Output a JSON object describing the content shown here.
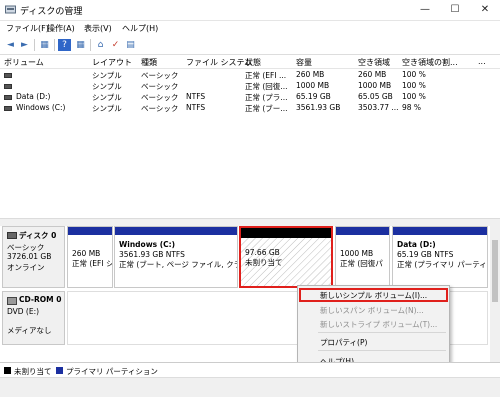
{
  "window": {
    "title": "ディスクの管理"
  },
  "window_buttons": {
    "minimize": "—",
    "maximize": "☐",
    "close": "✕"
  },
  "menu": [
    "ファイル(F)",
    "操作(A)",
    "表示(V)",
    "ヘルプ(H)"
  ],
  "toolbar": [
    "◄",
    "►",
    "▦",
    "?",
    "▦",
    "⌂",
    "✓",
    "▤"
  ],
  "columns": [
    "ボリューム",
    "レイアウト",
    "種類",
    "ファイル システム",
    "状態",
    "容量",
    "空き領域",
    "空き領域の割...",
    "..."
  ],
  "volumes": [
    {
      "name": "",
      "layout": "シンプル",
      "type": "ベーシック",
      "fs": "",
      "status": "正常 (EFI ...",
      "capacity": "260 MB",
      "free": "260 MB",
      "pct": "100 %"
    },
    {
      "name": "",
      "layout": "シンプル",
      "type": "ベーシック",
      "fs": "",
      "status": "正常 (回復...",
      "capacity": "1000 MB",
      "free": "1000 MB",
      "pct": "100 %"
    },
    {
      "name": "Data (D:)",
      "layout": "シンプル",
      "type": "ベーシック",
      "fs": "NTFS",
      "status": "正常 (プラ...",
      "capacity": "65.19 GB",
      "free": "65.05 GB",
      "pct": "100 %"
    },
    {
      "name": "Windows (C:)",
      "layout": "シンプル",
      "type": "ベーシック",
      "fs": "NTFS",
      "status": "正常 (ブー...",
      "capacity": "3561.93 GB",
      "free": "3503.77 ...",
      "pct": "98 %"
    }
  ],
  "disk0": {
    "name": "ディスク 0",
    "kind": "ベーシック",
    "size": "3726.01 GB",
    "state": "オンライン",
    "partitions": [
      {
        "title": "",
        "line1": "260 MB",
        "line2": "正常 (EFI シ"
      },
      {
        "title": "Windows (C:)",
        "line1": "3561.93 GB NTFS",
        "line2": "正常 (ブート, ページ ファイル, クラッシュ"
      },
      {
        "title": "",
        "line1": "97.66 GB",
        "line2": "未割り当て"
      },
      {
        "title": "",
        "line1": "1000 MB",
        "line2": "正常 (回復パ"
      },
      {
        "title": "Data (D:)",
        "line1": "65.19 GB NTFS",
        "line2": "正常 (プライマリ パーティショ"
      }
    ]
  },
  "cdrom0": {
    "name": "CD-ROM 0",
    "drive": "DVD (E:)",
    "state": "メディアなし"
  },
  "context_menu": [
    {
      "label": "新しいシンプル ボリューム(I)...",
      "enabled": true
    },
    {
      "label": "新しいスパン ボリューム(N)...",
      "enabled": false
    },
    {
      "label": "新しいストライプ ボリューム(T)...",
      "enabled": false
    },
    {
      "label": "プロパティ(P)",
      "enabled": true
    },
    {
      "label": "ヘルプ(H)",
      "enabled": true
    }
  ],
  "legend": {
    "unallocated": "未割り当て",
    "primary": "プライマリ パーティション"
  },
  "colors": {
    "primary_bar": "#1b2fa0",
    "unallocated_bar": "#000000",
    "highlight": "#e0201c"
  }
}
